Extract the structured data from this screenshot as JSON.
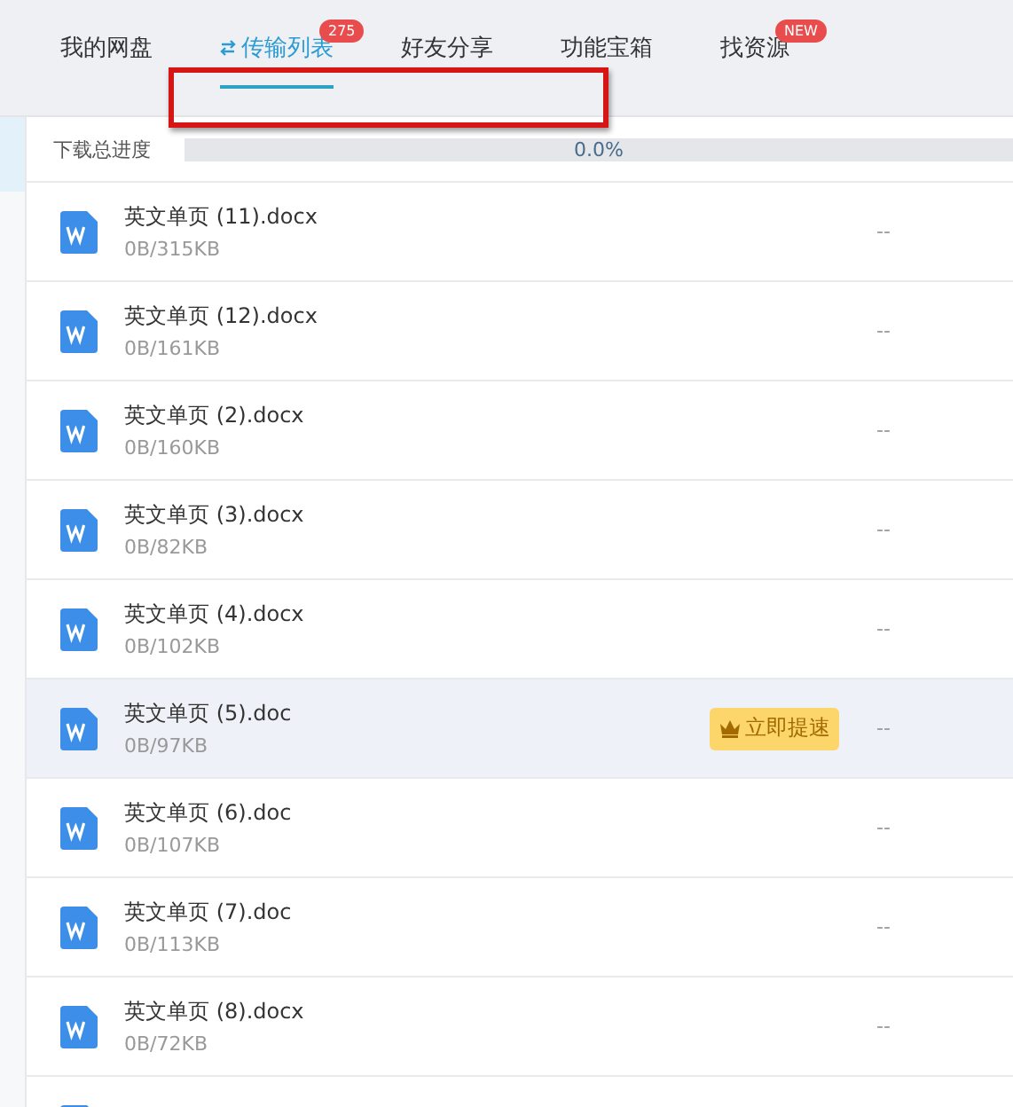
{
  "tabs": [
    {
      "label": "我的网盘",
      "selected": false
    },
    {
      "label": "传输列表",
      "selected": true,
      "badge": "275",
      "icon": true
    },
    {
      "label": "好友分享",
      "selected": false
    },
    {
      "label": "功能宝箱",
      "selected": false
    },
    {
      "label": "找资源",
      "selected": false,
      "badge": "NEW"
    }
  ],
  "progress": {
    "label": "下载总进度",
    "level": 0,
    "reading": "0.0%"
  },
  "files": [
    {
      "name": "英文单页 (11).docx",
      "size": "0B/315KB",
      "status": "--",
      "hovered": false
    },
    {
      "name": "英文单页 (12).docx",
      "size": "0B/161KB",
      "status": "--",
      "hovered": false
    },
    {
      "name": "英文单页 (2).docx",
      "size": "0B/160KB",
      "status": "--",
      "hovered": false
    },
    {
      "name": "英文单页 (3).docx",
      "size": "0B/82KB",
      "status": "--",
      "hovered": false
    },
    {
      "name": "英文单页 (4).docx",
      "size": "0B/102KB",
      "status": "--",
      "hovered": false
    },
    {
      "name": "英文单页 (5).doc",
      "size": "0B/97KB",
      "status": "--",
      "hovered": true,
      "action": "立即提速"
    },
    {
      "name": "英文单页 (6).doc",
      "size": "0B/107KB",
      "status": "--",
      "hovered": false
    },
    {
      "name": "英文单页 (7).doc",
      "size": "0B/113KB",
      "status": "--",
      "hovered": false
    },
    {
      "name": "英文单页 (8).docx",
      "size": "0B/72KB",
      "status": "--",
      "hovered": false
    }
  ]
}
